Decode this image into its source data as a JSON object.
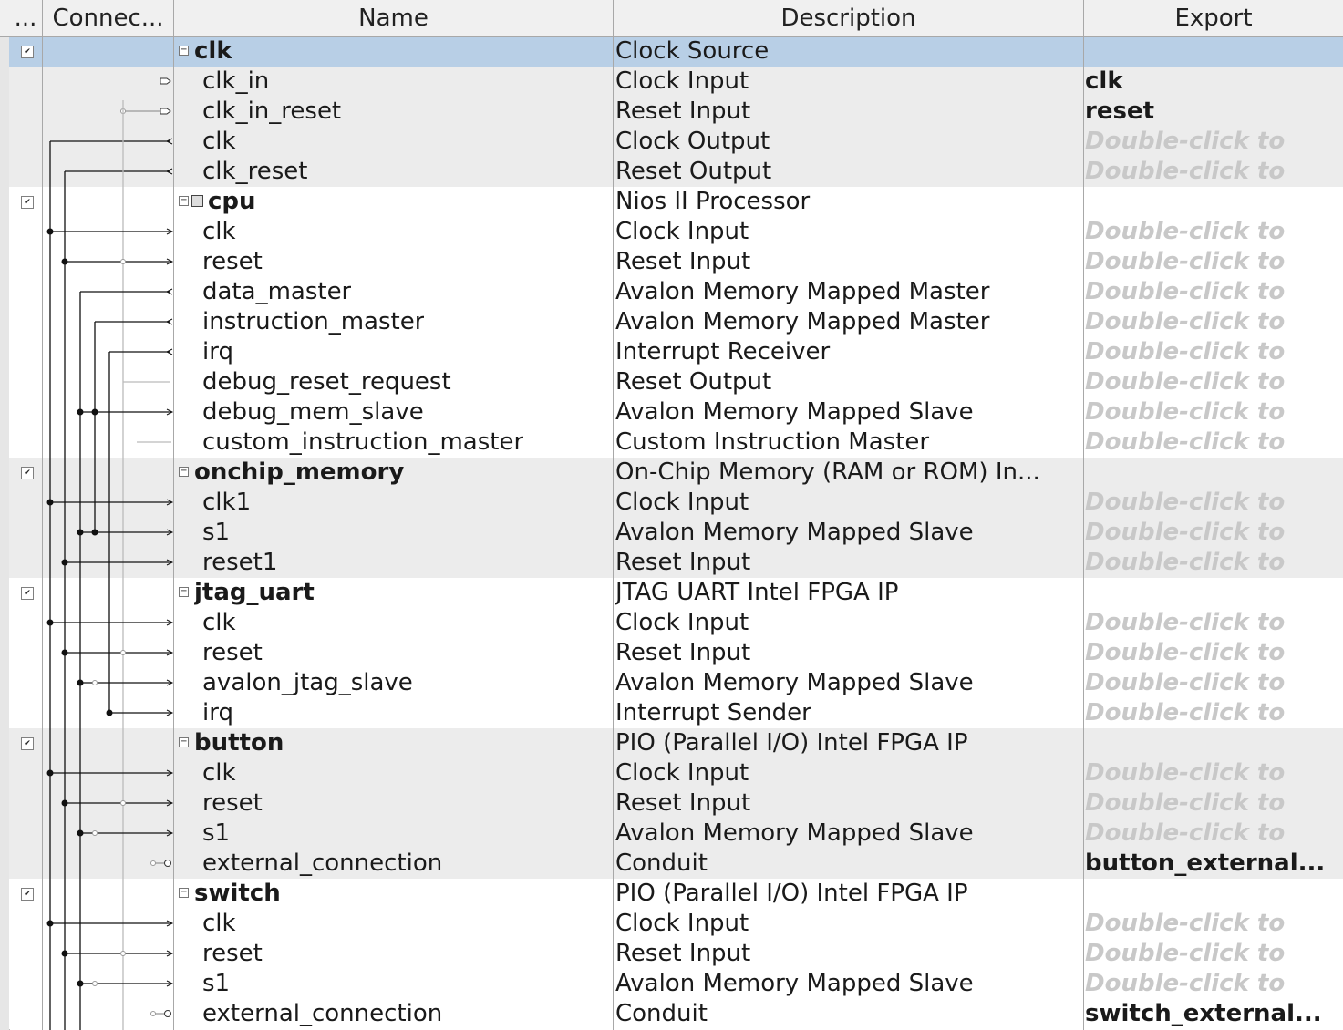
{
  "header": {
    "use_label": "...",
    "connections_label": "Connec...",
    "name_label": "Name",
    "description_label": "Description",
    "export_label": "Export"
  },
  "export_hint": "Double-click to",
  "colors": {
    "selected_row": "#b8cfe6",
    "gray_group": "#ececec",
    "white_group": "#ffffff",
    "hint_text": "#c8c8c8"
  },
  "components": [
    {
      "name": "clk",
      "description": "Clock Source",
      "export": "",
      "checked": true,
      "selected": true,
      "icon": "",
      "interfaces": [
        {
          "name": "clk_in",
          "description": "Clock Input",
          "export": "clk",
          "exported": true
        },
        {
          "name": "clk_in_reset",
          "description": "Reset Input",
          "export": "reset",
          "exported": true
        },
        {
          "name": "clk",
          "description": "Clock Output",
          "export": "",
          "exported": false
        },
        {
          "name": "clk_reset",
          "description": "Reset Output",
          "export": "",
          "exported": false
        }
      ]
    },
    {
      "name": "cpu",
      "description": "Nios II Processor",
      "export": "",
      "checked": true,
      "selected": false,
      "icon": "processor-icon",
      "interfaces": [
        {
          "name": "clk",
          "description": "Clock Input",
          "export": "",
          "exported": false
        },
        {
          "name": "reset",
          "description": "Reset Input",
          "export": "",
          "exported": false
        },
        {
          "name": "data_master",
          "description": "Avalon Memory Mapped Master",
          "export": "",
          "exported": false
        },
        {
          "name": "instruction_master",
          "description": "Avalon Memory Mapped Master",
          "export": "",
          "exported": false
        },
        {
          "name": "irq",
          "description": "Interrupt Receiver",
          "export": "",
          "exported": false
        },
        {
          "name": "debug_reset_request",
          "description": "Reset Output",
          "export": "",
          "exported": false
        },
        {
          "name": "debug_mem_slave",
          "description": "Avalon Memory Mapped Slave",
          "export": "",
          "exported": false
        },
        {
          "name": "custom_instruction_master",
          "description": "Custom Instruction Master",
          "export": "",
          "exported": false
        }
      ]
    },
    {
      "name": "onchip_memory",
      "description": "On-Chip Memory (RAM or ROM) In...",
      "export": "",
      "checked": true,
      "selected": false,
      "icon": "",
      "interfaces": [
        {
          "name": "clk1",
          "description": "Clock Input",
          "export": "",
          "exported": false
        },
        {
          "name": "s1",
          "description": "Avalon Memory Mapped Slave",
          "export": "",
          "exported": false
        },
        {
          "name": "reset1",
          "description": "Reset Input",
          "export": "",
          "exported": false
        }
      ]
    },
    {
      "name": "jtag_uart",
      "description": "JTAG UART Intel FPGA IP",
      "export": "",
      "checked": true,
      "selected": false,
      "icon": "",
      "interfaces": [
        {
          "name": "clk",
          "description": "Clock Input",
          "export": "",
          "exported": false
        },
        {
          "name": "reset",
          "description": "Reset Input",
          "export": "",
          "exported": false
        },
        {
          "name": "avalon_jtag_slave",
          "description": "Avalon Memory Mapped Slave",
          "export": "",
          "exported": false
        },
        {
          "name": "irq",
          "description": "Interrupt Sender",
          "export": "",
          "exported": false
        }
      ]
    },
    {
      "name": "button",
      "description": "PIO (Parallel I/O) Intel FPGA IP",
      "export": "",
      "checked": true,
      "selected": false,
      "icon": "",
      "interfaces": [
        {
          "name": "clk",
          "description": "Clock Input",
          "export": "",
          "exported": false
        },
        {
          "name": "reset",
          "description": "Reset Input",
          "export": "",
          "exported": false
        },
        {
          "name": "s1",
          "description": "Avalon Memory Mapped Slave",
          "export": "",
          "exported": false
        },
        {
          "name": "external_connection",
          "description": "Conduit",
          "export": "button_external...",
          "exported": true
        }
      ]
    },
    {
      "name": "switch",
      "description": "PIO (Parallel I/O) Intel FPGA IP",
      "export": "",
      "checked": true,
      "selected": false,
      "icon": "",
      "interfaces": [
        {
          "name": "clk",
          "description": "Clock Input",
          "export": "",
          "exported": false
        },
        {
          "name": "reset",
          "description": "Reset Input",
          "export": "",
          "exported": false
        },
        {
          "name": "s1",
          "description": "Avalon Memory Mapped Slave",
          "export": "",
          "exported": false
        },
        {
          "name": "external_connection",
          "description": "Conduit",
          "export": "switch_external...",
          "exported": true
        }
      ]
    }
  ]
}
